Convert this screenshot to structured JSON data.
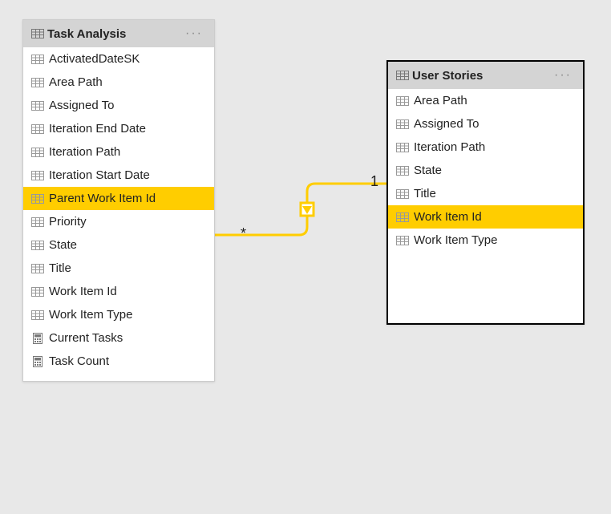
{
  "tables": {
    "left": {
      "title": "Task Analysis",
      "fields": [
        {
          "label": "ActivatedDateSK",
          "icon": "column",
          "highlight": false
        },
        {
          "label": "Area Path",
          "icon": "column",
          "highlight": false
        },
        {
          "label": "Assigned To",
          "icon": "column",
          "highlight": false
        },
        {
          "label": "Iteration End Date",
          "icon": "column",
          "highlight": false
        },
        {
          "label": "Iteration Path",
          "icon": "column",
          "highlight": false
        },
        {
          "label": "Iteration Start Date",
          "icon": "column",
          "highlight": false
        },
        {
          "label": "Parent Work Item Id",
          "icon": "column",
          "highlight": true
        },
        {
          "label": "Priority",
          "icon": "column",
          "highlight": false
        },
        {
          "label": "State",
          "icon": "column",
          "highlight": false
        },
        {
          "label": "Title",
          "icon": "column",
          "highlight": false
        },
        {
          "label": "Work Item Id",
          "icon": "column",
          "highlight": false
        },
        {
          "label": "Work Item Type",
          "icon": "column",
          "highlight": false
        },
        {
          "label": "Current Tasks",
          "icon": "measure",
          "highlight": false
        },
        {
          "label": "Task Count",
          "icon": "measure",
          "highlight": false
        }
      ]
    },
    "right": {
      "title": "User Stories",
      "fields": [
        {
          "label": "Area Path",
          "icon": "column",
          "highlight": false
        },
        {
          "label": "Assigned To",
          "icon": "column",
          "highlight": false
        },
        {
          "label": "Iteration Path",
          "icon": "column",
          "highlight": false
        },
        {
          "label": "State",
          "icon": "column",
          "highlight": false
        },
        {
          "label": "Title",
          "icon": "column",
          "highlight": false
        },
        {
          "label": "Work Item Id",
          "icon": "column",
          "highlight": true
        },
        {
          "label": "Work Item Type",
          "icon": "column",
          "highlight": false
        }
      ]
    }
  },
  "relationship": {
    "left_cardinality": "*",
    "right_cardinality": "1",
    "color": "#ffcd00"
  }
}
